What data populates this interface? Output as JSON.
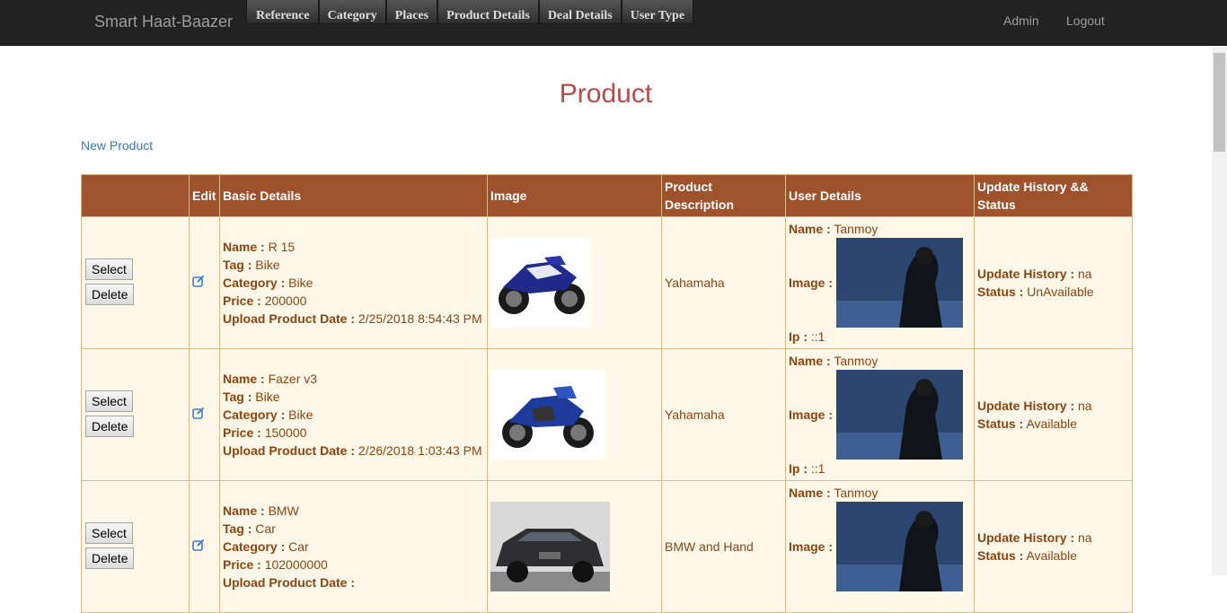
{
  "nav": {
    "brand": "Smart Haat-Baazer",
    "menu": [
      "Reference",
      "Category",
      "Places",
      "Product Details",
      "Deal Details",
      "User Type"
    ],
    "admin": "Admin",
    "logout": "Logout"
  },
  "page": {
    "title": "Product",
    "new_link": "New Product"
  },
  "table": {
    "headers": [
      "",
      "Edit",
      "Basic Details",
      "Image",
      "Product Description",
      "User Details",
      "Update History && Status"
    ],
    "labels": {
      "name": "Name :",
      "tag": "Tag :",
      "category": "Category :",
      "price": "Price :",
      "upload": "Upload Product Date :",
      "image": "Image :",
      "ip": "Ip :",
      "history": "Update History :",
      "status": "Status :"
    },
    "buttons": {
      "select": "Select",
      "delete": "Delete"
    },
    "rows": [
      {
        "name": "R 15",
        "tag": "Bike",
        "category": "Bike",
        "price": "200000",
        "upload": "2/25/2018 8:54:43 PM",
        "description": "Yahamaha",
        "user_name": "Tanmoy",
        "ip": "::1",
        "history": "na",
        "status": "UnAvailable"
      },
      {
        "name": "Fazer v3",
        "tag": "Bike",
        "category": "Bike",
        "price": "150000",
        "upload": "2/26/2018 1:03:43 PM",
        "description": "Yahamaha",
        "user_name": "Tanmoy",
        "ip": "::1",
        "history": "na",
        "status": "Available"
      },
      {
        "name": "BMW",
        "tag": "Car",
        "category": "Car",
        "price": "102000000",
        "upload": "",
        "description": "BMW and Hand",
        "user_name": "Tanmoy",
        "ip": "",
        "history": "na",
        "status": "Available"
      }
    ]
  },
  "colors": {
    "header_bg": "#a0522d",
    "row_bg": "#fff7e7",
    "row_text": "#8c4510",
    "title": "#b94a48",
    "link": "#337ab7"
  }
}
